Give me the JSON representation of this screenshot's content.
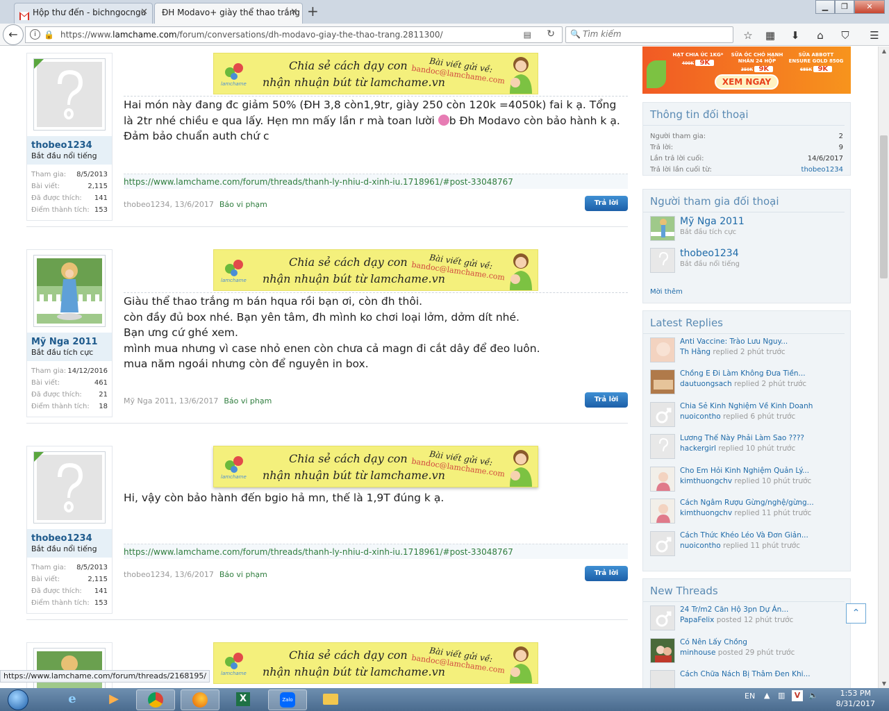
{
  "browser": {
    "tabs": [
      {
        "title": "Hộp thư đến - bichngocngu",
        "active": false
      },
      {
        "title": "ĐH Modavo+ giày thể thao trắng",
        "active": true
      }
    ],
    "url_prefix": "https://www.",
    "url_domain": "lamchame.com",
    "url_path": "/forum/conversations/dh-modavo-giay-the-thao-trang.2811300/",
    "search_placeholder": "Tìm kiếm",
    "status_url": "https://www.lamchame.com/forum/threads/2168195/"
  },
  "banner": {
    "line1": "Chia sẻ cách dạy con",
    "line2": "nhận nhuận bút từ lamchame.vn",
    "send_to": "Bài viết gửi về:",
    "email": "bandoc@lamchame.com",
    "logo_text": "lamchame"
  },
  "messages": [
    {
      "user": "thobeo1234",
      "user_title": "Bắt đầu nổi tiếng",
      "stats": [
        {
          "label": "Tham gia:",
          "value": "8/5/2013"
        },
        {
          "label": "Bài viết:",
          "value": "2,115"
        },
        {
          "label": "Đã được thích:",
          "value": "141"
        },
        {
          "label": "Điểm thành tích:",
          "value": "153"
        }
      ],
      "text_before_emoji": "Hai món này đang đc giảm 50% (ĐH 3,8 còn1,9tr, giày 250 còn 120k =4050k) fai k ạ. Tổng là 2tr nhé chiều e qua lấy. Hẹn mn mấy lần r mà toan lười ",
      "text_after_emoji": "b Đh Modavo còn bảo hành k ạ. Đảm bảo chuẩn auth chứ c",
      "signature": "https://www.lamchame.com/forum/threads/thanh-ly-nhiu-d-xinh-iu.1718961/#post-33048767",
      "meta": "thobeo1234, 13/6/2017",
      "report": "Báo vi phạm",
      "reply": "Trả lời"
    },
    {
      "user": "Mỹ Nga 2011",
      "user_title": "Bắt đầu tích cực",
      "stats": [
        {
          "label": "Tham gia:",
          "value": "14/12/2016"
        },
        {
          "label": "Bài viết:",
          "value": "461"
        },
        {
          "label": "Đã được thích:",
          "value": "21"
        },
        {
          "label": "Điểm thành tích:",
          "value": "18"
        }
      ],
      "lines": [
        "Giàu thể thao trắng m bán hqua rồi bạn ơi, còn đh thôi.",
        "còn đầy đủ box nhé. Bạn yên tâm, đh mình ko chơi loại lởm, dởm dít nhé.",
        "Bạn ưng cứ ghé xem.",
        "mình mua nhưng vì case nhỏ enen còn chưa cả magn đi cắt dây để đeo luôn.",
        "mua năm ngoái nhưng còn để nguyên in box."
      ],
      "meta": "Mỹ Nga 2011, 13/6/2017",
      "report": "Báo vi phạm",
      "reply": "Trả lời"
    },
    {
      "user": "thobeo1234",
      "user_title": "Bắt đầu nổi tiếng",
      "stats": [
        {
          "label": "Tham gia:",
          "value": "8/5/2013"
        },
        {
          "label": "Bài viết:",
          "value": "2,115"
        },
        {
          "label": "Đã được thích:",
          "value": "141"
        },
        {
          "label": "Điểm thành tích:",
          "value": "153"
        }
      ],
      "text": "Hi, vậy còn bảo hành đến bgio hả mn, thế là 1,9T đúng k ạ.",
      "signature": "https://www.lamchame.com/forum/threads/thanh-ly-nhiu-d-xinh-iu.1718961/#post-33048767",
      "meta": "thobeo1234, 13/6/2017",
      "report": "Báo vi phạm",
      "reply": "Trả lời"
    }
  ],
  "ad": {
    "col1_title": "HẠT CHIA ÚC 1KG*",
    "col1_price": "9K",
    "col1_old": "400K",
    "col2_title": "SỮA ÓC CHÓ HẠNH NHÂN 24 HỘP",
    "col2_price": "9K",
    "col2_old": "350K",
    "col3_title": "SỮA ABBOTT ENSURE GOLD 850G",
    "col3_price": "9K",
    "col3_old": "685K",
    "cta": "XEM NGAY"
  },
  "conversation_info": {
    "heading": "Thông tin đối thoại",
    "rows": [
      {
        "label": "Người tham gia:",
        "value": "2"
      },
      {
        "label": "Trả lời:",
        "value": "9"
      },
      {
        "label": "Lần trả lời cuối:",
        "value": "14/6/2017"
      },
      {
        "label": "Trả lời lần cuối từ:",
        "value": "thobeo1234"
      }
    ]
  },
  "participants": {
    "heading": "Người tham gia đối thoại",
    "people": [
      {
        "name": "Mỹ Nga 2011",
        "title": "Bắt đầu tích cực"
      },
      {
        "name": "thobeo1234",
        "title": "Bắt đầu nổi tiếng"
      }
    ],
    "more": "Mời thêm"
  },
  "latest_replies": {
    "heading": "Latest Replies",
    "items": [
      {
        "title": "Anti Vaccine: Trào Lưu Nguy...",
        "user": "Th Hằng",
        "action": " replied 2 phút trước"
      },
      {
        "title": "Chồng E Đi Làm Không Đưa Tiền...",
        "user": "dautuongsach",
        "action": " replied 2 phút trước"
      },
      {
        "title": "Chia Sẻ Kinh Nghiệm Về Kinh Doanh",
        "user": "nuoicontho",
        "action": " replied 6 phút trước"
      },
      {
        "title": "Lương Thế Này Phải Làm Sao ????",
        "user": "hackergirl",
        "action": " replied 10 phút trước"
      },
      {
        "title": "Cho Em Hỏi Kinh Nghiệm Quản Lý...",
        "user": "kimthuongchv",
        "action": " replied 10 phút trước"
      },
      {
        "title": "Cách Ngâm Rượu Gừng/nghệ/gừng...",
        "user": "kimthuongchv",
        "action": " replied 11 phút trước"
      },
      {
        "title": "Cách Thức Khéo Léo Và Đơn Giản...",
        "user": "nuoicontho",
        "action": " replied 11 phút trước"
      }
    ]
  },
  "new_threads": {
    "heading": "New Threads",
    "items": [
      {
        "title": "24 Tr/m2 Căn Hộ 3pn Dự Án...",
        "user": "PapaFelix",
        "action": " posted 12 phút trước"
      },
      {
        "title": "Có Nên Lấy Chồng",
        "user": "minhouse",
        "action": " posted 29 phút trước"
      },
      {
        "title": "Cách Chữa Nách Bị Thâm Đen Khi...",
        "user": "",
        "action": ""
      }
    ]
  },
  "taskbar": {
    "lang": "EN",
    "time": "1:53 PM",
    "date": "8/31/2017"
  },
  "colors": {
    "accent_blue": "#1e6aa8",
    "signature_green": "#2f7d3e",
    "reply_button": "#2a75bd"
  }
}
